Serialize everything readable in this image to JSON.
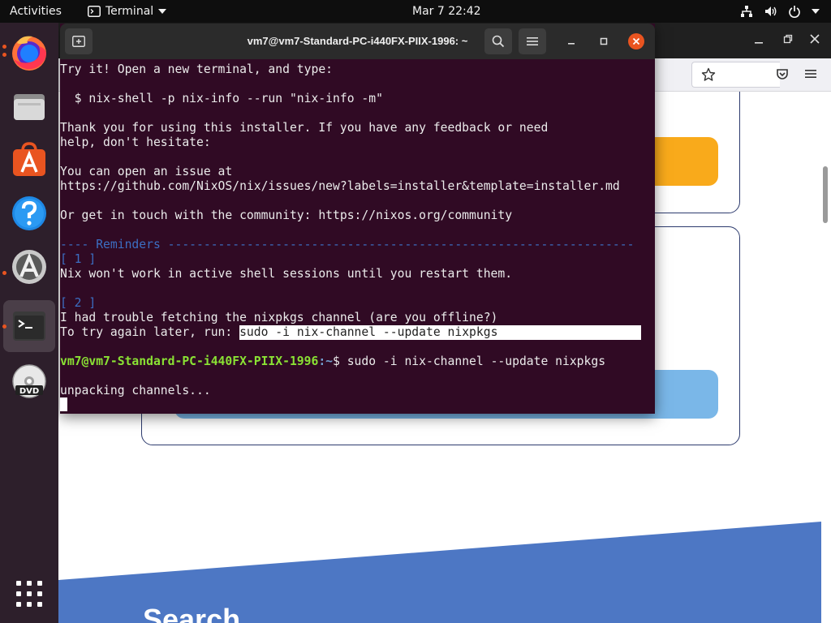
{
  "topbar": {
    "activities": "Activities",
    "app_name": "Terminal",
    "clock": "Mar 7  22:42"
  },
  "dock": {
    "items": [
      "firefox-icon",
      "files-icon",
      "app-center-icon",
      "help-icon",
      "software-updater-icon",
      "terminal-icon",
      "dvd-icon",
      "show-applications-icon"
    ],
    "active": "terminal-icon"
  },
  "terminal": {
    "title": "vm7@vm7-Standard-PC-i440FX-PIIX-1996: ~",
    "lines": {
      "l1": "Try it! Open a new terminal, and type:",
      "l2": "  $ nix-shell -p nix-info --run \"nix-info -m\"",
      "l3": "Thank you for using this installer. If you have any feedback or need",
      "l4": "help, don't hesitate:",
      "l5": "You can open an issue at",
      "l6": "https://github.com/NixOS/nix/issues/new?labels=installer&template=installer.md",
      "l7": "Or get in touch with the community: https://nixos.org/community",
      "l8": "---- Reminders -----------------------------------------------------------------",
      "l9": "[ 1 ]",
      "l10": "Nix won't work in active shell sessions until you restart them.",
      "l11": "[ 2 ]",
      "l12": "I had trouble fetching the nixpkgs channel (are you offline?)",
      "l13a": "To try again later, run: ",
      "l13b": "sudo -i nix-channel --update nixpkgs",
      "prompt_user": "vm7@vm7-Standard-PC-i440FX-PIIX-1996",
      "prompt_path": ":~",
      "command": "$ sudo -i nix-channel --update nixpkgs",
      "l15": "unpacking channels..."
    }
  },
  "browser": {
    "heading": "Search"
  },
  "colors": {
    "terminal_bg": "#300a24",
    "prompt_user": "#8ae234",
    "prompt_path": "#729fcf",
    "accent_orange": "#f9aa1b",
    "accent_blue": "#7ab7e8",
    "band_blue": "#4d77c4"
  }
}
